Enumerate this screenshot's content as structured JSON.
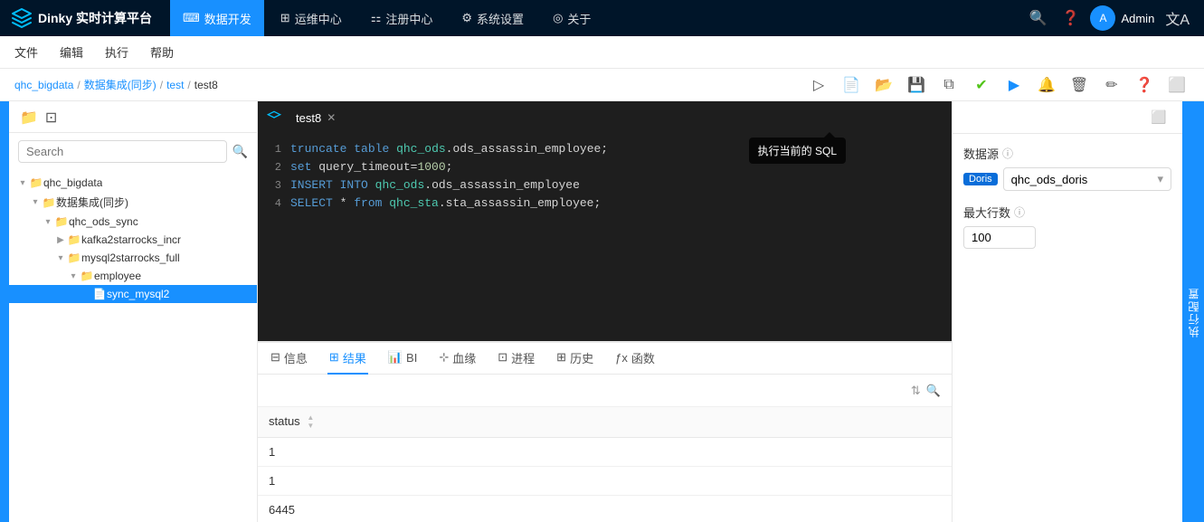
{
  "app": {
    "title": "Dinky 实时计算平台",
    "logo_text": "Dinky 实时计算平台"
  },
  "top_nav": {
    "items": [
      {
        "id": "data_dev",
        "label": "数据开发",
        "icon": "code-icon",
        "active": true
      },
      {
        "id": "ops_center",
        "label": "运维中心",
        "icon": "monitor-icon"
      },
      {
        "id": "register_center",
        "label": "注册中心",
        "icon": "grid-icon"
      },
      {
        "id": "system_settings",
        "label": "系统设置",
        "icon": "settings-icon"
      },
      {
        "id": "about",
        "label": "关于",
        "icon": "info-circle-icon"
      }
    ],
    "right": {
      "search_icon": "search-icon",
      "help_icon": "help-icon",
      "admin_label": "Admin",
      "lang_icon": "A文"
    }
  },
  "menu_bar": {
    "items": [
      "文件",
      "编辑",
      "执行",
      "帮助"
    ]
  },
  "breadcrumb": {
    "items": [
      "qhc_bigdata",
      "数据集成(同步)",
      "test",
      "test8"
    ]
  },
  "toolbar": {
    "tooltip": "执行当前的 SQL",
    "icons": [
      "submit-icon",
      "new-icon",
      "open-icon",
      "save-icon",
      "copy-icon",
      "check-icon",
      "run-icon",
      "bell-icon",
      "delete-icon",
      "edit-icon",
      "help-icon",
      "collapse-icon"
    ]
  },
  "left_panel": {
    "search_placeholder": "Search",
    "tree": [
      {
        "level": 1,
        "label": "qhc_bigdata",
        "type": "folder",
        "expanded": true
      },
      {
        "level": 2,
        "label": "数据集成(同步)",
        "type": "folder",
        "expanded": true
      },
      {
        "level": 3,
        "label": "qhc_ods_sync",
        "type": "folder",
        "expanded": true
      },
      {
        "level": 4,
        "label": "kafka2starrocks_incr",
        "type": "folder",
        "expanded": false
      },
      {
        "level": 4,
        "label": "mysql2starrocks_full",
        "type": "folder",
        "expanded": true
      },
      {
        "level": 5,
        "label": "employee",
        "type": "folder",
        "expanded": true
      },
      {
        "level": 6,
        "label": "sync_mysql2",
        "type": "file",
        "selected": true
      }
    ]
  },
  "editor": {
    "tab_name": "test8",
    "lines": [
      {
        "num": 1,
        "code": "truncate table qhc_ods.ods_assassin_employee;"
      },
      {
        "num": 2,
        "code": "set query_timeout=1000;"
      },
      {
        "num": 3,
        "code": "INSERT INTO qhc_ods.ods_assassin_employee"
      },
      {
        "num": 4,
        "code": "SELECT * from qhc_sta.sta_assassin_employee;"
      }
    ]
  },
  "bottom_tabs": {
    "items": [
      {
        "id": "info",
        "label": "信息",
        "icon": "info-tab-icon"
      },
      {
        "id": "result",
        "label": "结果",
        "icon": "table-icon",
        "active": true
      },
      {
        "id": "bi",
        "label": "BI",
        "icon": "chart-icon"
      },
      {
        "id": "lineage",
        "label": "血缘",
        "icon": "lineage-icon"
      },
      {
        "id": "process",
        "label": "进程",
        "icon": "process-icon"
      },
      {
        "id": "history",
        "label": "历史",
        "icon": "history-icon"
      },
      {
        "id": "functions",
        "label": "函数",
        "icon": "func-icon"
      }
    ]
  },
  "result_table": {
    "columns": [
      {
        "name": "status"
      }
    ],
    "rows": [
      {
        "status": "1"
      },
      {
        "status": "1"
      },
      {
        "status": "6445"
      }
    ]
  },
  "right_config": {
    "datasource_label": "数据源",
    "datasource_badge": "Doris",
    "datasource_value": "qhc_ods_doris",
    "maxrows_label": "最大行数",
    "maxrows_value": "100",
    "panel_label": "执行配置"
  },
  "colors": {
    "nav_bg": "#001529",
    "active_nav": "#1890ff",
    "editor_bg": "#1e1e1e",
    "far_right_bg": "#1890ff"
  }
}
